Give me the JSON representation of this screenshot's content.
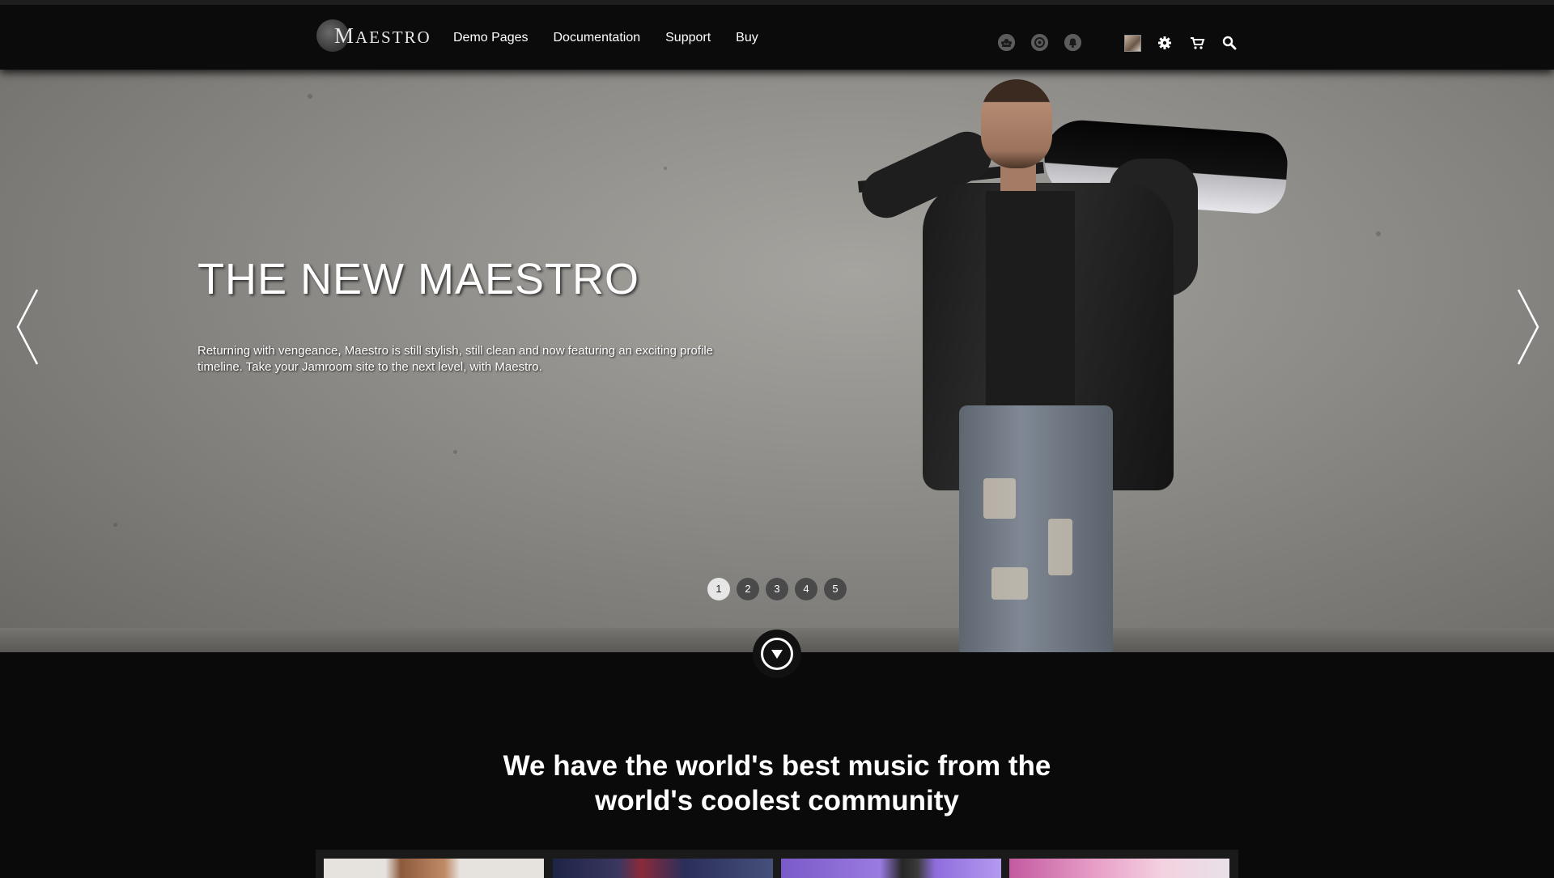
{
  "header": {
    "logo": {
      "initial": "M",
      "rest": "AESTRO"
    },
    "nav": [
      {
        "label": "Demo Pages"
      },
      {
        "label": "Documentation"
      },
      {
        "label": "Support"
      },
      {
        "label": "Buy"
      }
    ],
    "social_icons": [
      "community-icon",
      "at-icon",
      "notification-icon"
    ],
    "tool_icons": [
      "avatar",
      "gear-icon",
      "cart-icon",
      "search-icon"
    ]
  },
  "hero": {
    "title": "THE NEW MAESTRO",
    "text": "Returning with vengeance, Maestro is still stylish, still clean and now featuring an exciting profile timeline. Take your Jamroom site to the next level, with Maestro.",
    "slides": [
      "1",
      "2",
      "3",
      "4",
      "5"
    ],
    "active_slide": "1"
  },
  "tagline": {
    "line1": "We have the world's best music from the",
    "line2": "world's coolest community"
  },
  "colors": {
    "background": "#0a0a0a",
    "header": "#0b0b0b",
    "dot_active": "#e6e6e6",
    "dot_inactive": "#4a4a4a"
  }
}
